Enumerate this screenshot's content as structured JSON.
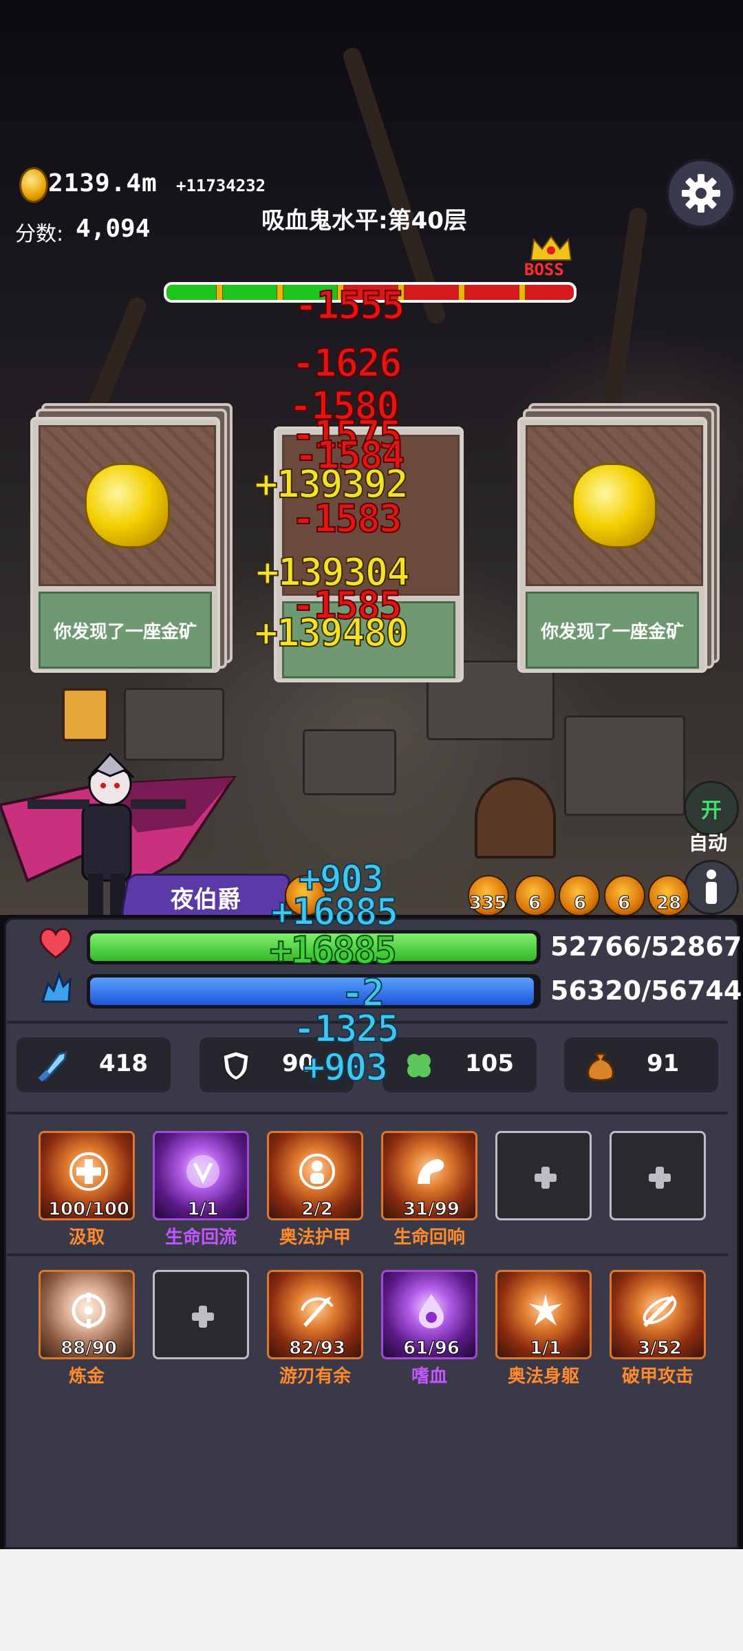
{
  "hud": {
    "gold_amount": "2139.4m",
    "gold_rate": "+11734232",
    "score_label": "分数:",
    "score_value": "4,094",
    "level_label": "吸血鬼水平:第40层",
    "boss_label": "BOSS",
    "boss_health_fraction": 0.43
  },
  "damage_numbers": {
    "red": [
      "-1555",
      "-1626",
      "-1580",
      "-1575",
      "-1584",
      "-1583",
      "-1585"
    ],
    "yellow": [
      "+139392",
      "+139304",
      "+139480"
    ],
    "player_heal": [
      "+903",
      "+16885",
      "+16885",
      "+903"
    ],
    "player_dmg": [
      "-2",
      "-1325"
    ]
  },
  "cards": [
    {
      "caption": "你发现了一座金矿"
    },
    {
      "caption": "你发现了一座金矿"
    }
  ],
  "controls": {
    "auto_toggle_label": "开",
    "auto_label": "自动"
  },
  "hero": {
    "name": "夜伯爵",
    "buffs": [
      "335",
      "6",
      "6",
      "6",
      "28"
    ],
    "hp": "52766/52867",
    "hp_fraction": 0.998,
    "mp": "56320/56744",
    "mp_fraction": 0.993
  },
  "stats": [
    {
      "icon": "sword-icon",
      "value": "418"
    },
    {
      "icon": "shield-icon",
      "value": "90"
    },
    {
      "icon": "clover-icon",
      "value": "105"
    },
    {
      "icon": "money-bag-icon",
      "value": "91"
    }
  ],
  "skills_row1": [
    {
      "count": "100/100",
      "name": "汲取",
      "color": "orange"
    },
    {
      "count": "1/1",
      "name": "生命回流",
      "color": "purple"
    },
    {
      "count": "2/2",
      "name": "奥法护甲",
      "color": "orange"
    },
    {
      "count": "31/99",
      "name": "生命回响",
      "color": "orange"
    }
  ],
  "skills_row2": [
    {
      "count": "88/90",
      "name": "炼金",
      "color": "orange"
    },
    {
      "count": "82/93",
      "name": "游刃有余",
      "color": "orange"
    },
    {
      "count": "61/96",
      "name": "嗜血",
      "color": "purple"
    },
    {
      "count": "1/1",
      "name": "奥法身躯",
      "color": "orange"
    },
    {
      "count": "3/52",
      "name": "破甲攻击",
      "color": "orange"
    }
  ]
}
